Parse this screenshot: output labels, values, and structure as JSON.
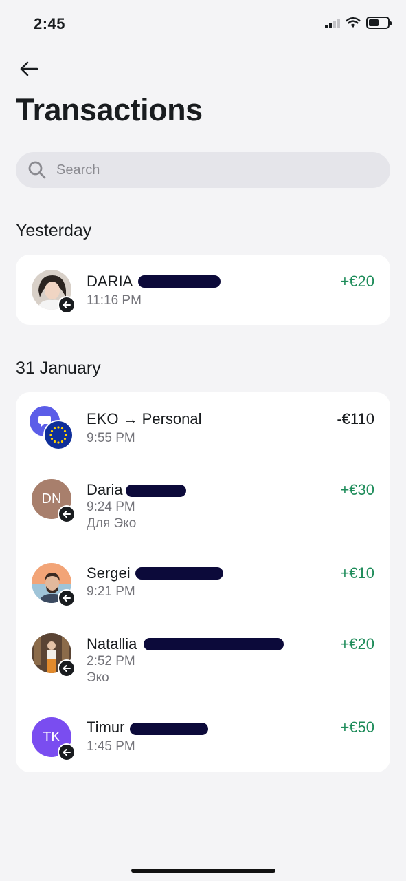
{
  "status_bar": {
    "time": "2:45"
  },
  "header": {
    "title": "Transactions"
  },
  "search": {
    "placeholder": "Search"
  },
  "groups": [
    {
      "label": "Yesterday",
      "items": [
        {
          "name": "DARIA",
          "time": "11:16 PM",
          "amount": "+€20",
          "avatar": "photo",
          "direction": "incoming"
        }
      ]
    },
    {
      "label": "31 January",
      "items": [
        {
          "name": "EKO → Personal",
          "time": "9:55 PM",
          "amount": "-€110",
          "avatar": "account-eu",
          "direction": "transfer"
        },
        {
          "name": "Daria",
          "time": "9:24 PM",
          "note": "Для Эко",
          "amount": "+€30",
          "avatar_initials": "DN",
          "avatar_color": "#a87f6c",
          "direction": "incoming"
        },
        {
          "name": "Sergei",
          "time": "9:21 PM",
          "amount": "+€10",
          "avatar": "photo",
          "direction": "incoming"
        },
        {
          "name": "Natallia",
          "time": "2:52 PM",
          "note": "Эко",
          "amount": "+€20",
          "avatar": "photo",
          "direction": "incoming"
        },
        {
          "name": "Timur",
          "time": "1:45 PM",
          "amount": "+€50",
          "avatar_initials": "TK",
          "avatar_color": "#7a4df0",
          "direction": "incoming"
        }
      ]
    }
  ],
  "colors": {
    "positive": "#1e8c5a",
    "negative": "#191c1f",
    "background": "#f4f4f6"
  }
}
